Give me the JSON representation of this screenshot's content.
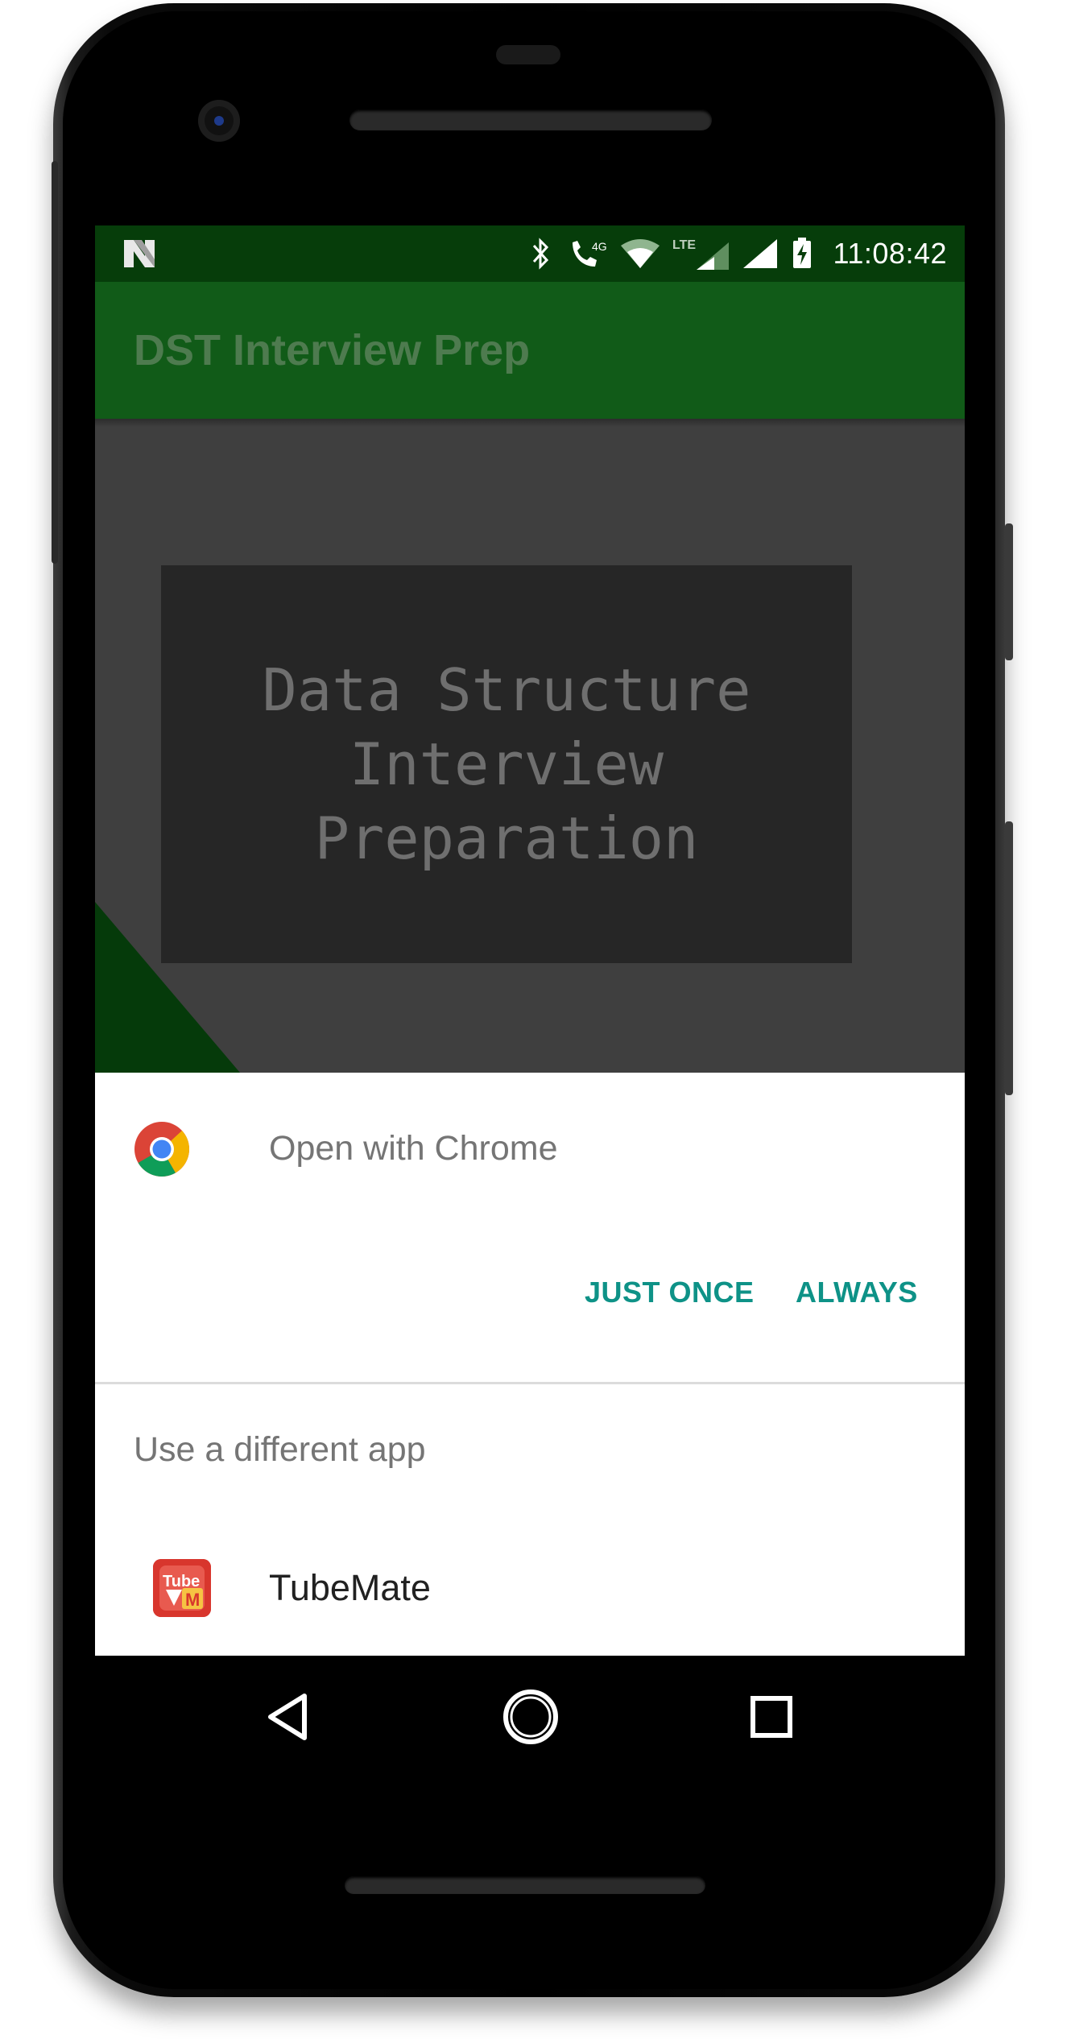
{
  "status_bar": {
    "time": "11:08:42",
    "network_label_4g": "4G",
    "network_label_lte": "LTE",
    "icons": [
      "notification-n-icon",
      "bluetooth-icon",
      "wifi-calling-icon",
      "wifi-icon",
      "lte-signal-icon",
      "signal-icon",
      "battery-charging-icon"
    ]
  },
  "app_bar": {
    "title": "DST Interview Prep",
    "background": "#115b18"
  },
  "banner": {
    "text": "Data Structure\nInterview\nPreparation"
  },
  "sheet": {
    "open_with_label": "Open with Chrome",
    "just_once_label": "JUST ONCE",
    "always_label": "ALWAYS",
    "different_app_label": "Use a different app",
    "apps": [
      {
        "name": "TubeMate",
        "icon": "tubemate-icon"
      }
    ],
    "accent_color": "#0e9287"
  },
  "nav_bar": {
    "buttons": [
      "back-icon",
      "home-icon",
      "recents-icon"
    ]
  }
}
